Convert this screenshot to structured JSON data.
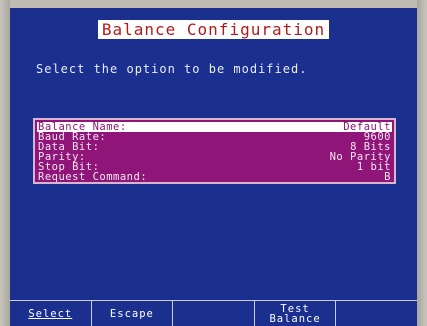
{
  "title": "Balance Configuration",
  "prompt": "Select the option to be modified.",
  "menu": {
    "items": [
      {
        "label": "Balance Name:",
        "value": "Default"
      },
      {
        "label": "Baud Rate:",
        "value": "9600"
      },
      {
        "label": "Data Bit:",
        "value": "8 Bits"
      },
      {
        "label": "Parity:",
        "value": "No Parity"
      },
      {
        "label": "Stop Bit:",
        "value": "1 bit"
      },
      {
        "label": "Request Command:",
        "value": "B"
      }
    ],
    "selected_index": 0
  },
  "softkeys": {
    "select": "Select",
    "escape": "Escape",
    "empty1": "",
    "test_balance_line1": "Test",
    "test_balance_line2": "Balance",
    "empty2": ""
  },
  "colors": {
    "screen_background": "#1a2f8e",
    "title_text": "#b01c1c",
    "menu_background": "#8f1678",
    "selection_highlight": "#ffffff"
  }
}
